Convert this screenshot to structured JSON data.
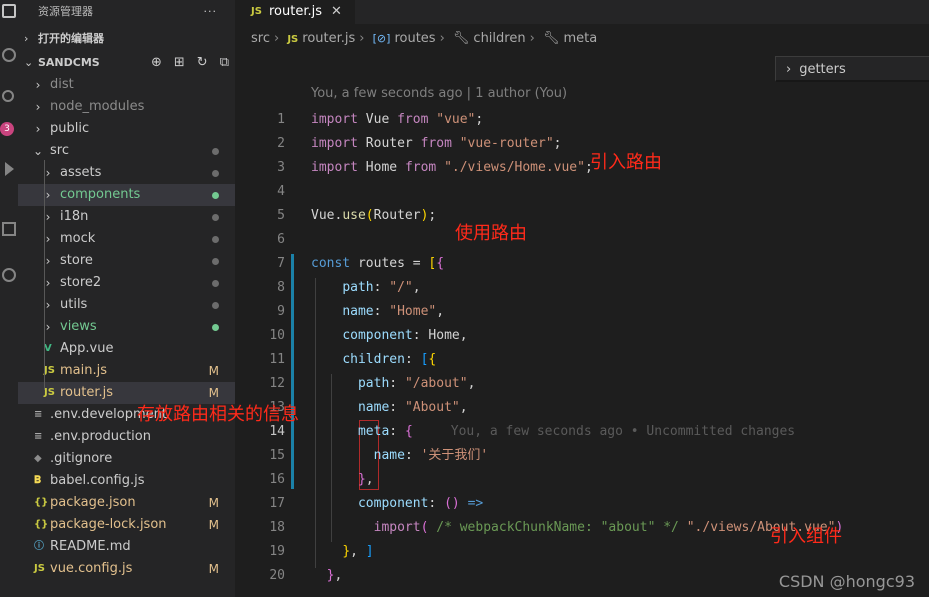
{
  "explorer": {
    "title": "资源管理器",
    "more": "···",
    "open_editors": "打开的编辑器",
    "project": "SANDCMS",
    "tools": [
      "⊕",
      "⊞",
      "↻",
      "⧉"
    ],
    "rows": [
      {
        "label": "dist",
        "kind": "folder",
        "indent": 0,
        "ignored": true
      },
      {
        "label": "node_modules",
        "kind": "folder",
        "indent": 0,
        "ignored": true
      },
      {
        "label": "public",
        "kind": "folder",
        "indent": 0
      },
      {
        "label": "src",
        "kind": "folder-open",
        "indent": 0,
        "status": "dot"
      },
      {
        "label": "assets",
        "kind": "folder",
        "indent": 1,
        "status": "dot"
      },
      {
        "label": "components",
        "kind": "folder",
        "indent": 1,
        "status": "dot-green",
        "selected": true
      },
      {
        "label": "i18n",
        "kind": "folder",
        "indent": 1,
        "status": "dot"
      },
      {
        "label": "mock",
        "kind": "folder",
        "indent": 1,
        "status": "dot"
      },
      {
        "label": "store",
        "kind": "folder",
        "indent": 1,
        "status": "dot"
      },
      {
        "label": "store2",
        "kind": "folder",
        "indent": 1,
        "status": "dot"
      },
      {
        "label": "utils",
        "kind": "folder",
        "indent": 1,
        "status": "dot"
      },
      {
        "label": "views",
        "kind": "folder",
        "indent": 1,
        "status": "dot-green"
      },
      {
        "label": "App.vue",
        "kind": "vue",
        "indent": 1
      },
      {
        "label": "main.js",
        "kind": "js",
        "indent": 1,
        "status": "M"
      },
      {
        "label": "router.js",
        "kind": "js",
        "indent": 1,
        "status": "M",
        "selected": true
      },
      {
        "label": ".env.development",
        "kind": "env",
        "indent": 0
      },
      {
        "label": ".env.production",
        "kind": "env",
        "indent": 0
      },
      {
        "label": ".gitignore",
        "kind": "git",
        "indent": 0
      },
      {
        "label": "babel.config.js",
        "kind": "babel",
        "indent": 0
      },
      {
        "label": "package.json",
        "kind": "json",
        "indent": 0,
        "status": "M"
      },
      {
        "label": "package-lock.json",
        "kind": "json",
        "indent": 0,
        "status": "M"
      },
      {
        "label": "README.md",
        "kind": "info",
        "indent": 0
      },
      {
        "label": "vue.config.js",
        "kind": "js",
        "indent": 0,
        "status": "M"
      }
    ]
  },
  "tab": {
    "icon": "JS",
    "label": "router.js",
    "close": "✕"
  },
  "breadcrumbs": [
    "src",
    "router.js",
    "routes",
    "children",
    "meta"
  ],
  "outline_popup": {
    "label": "getters"
  },
  "blame_header": "You, a few seconds ago | 1 author (You)",
  "inline_blame": "You, a few seconds ago • Uncommitted changes",
  "code_lines": [
    {
      "n": "1"
    },
    {
      "n": "2"
    },
    {
      "n": "3"
    },
    {
      "n": "4"
    },
    {
      "n": "5"
    },
    {
      "n": "6"
    },
    {
      "n": "7"
    },
    {
      "n": "8"
    },
    {
      "n": "9"
    },
    {
      "n": "10"
    },
    {
      "n": "11"
    },
    {
      "n": "12"
    },
    {
      "n": "13"
    },
    {
      "n": "14"
    },
    {
      "n": "15"
    },
    {
      "n": "16"
    },
    {
      "n": "17"
    },
    {
      "n": "18"
    },
    {
      "n": "19"
    },
    {
      "n": "20"
    }
  ],
  "annotations": {
    "import_router": "引入路由",
    "use_router": "使用路由",
    "router_info": "存放路由相关的信息",
    "import_component": "引入组件"
  },
  "watermark": "CSDN @hongc93",
  "colors": {
    "keyword": "#569cd6",
    "string": "#ce9178",
    "property": "#9cdcfe",
    "annotation": "#ff2a1a",
    "modified": "#e2c08d",
    "untracked": "#73c991"
  }
}
